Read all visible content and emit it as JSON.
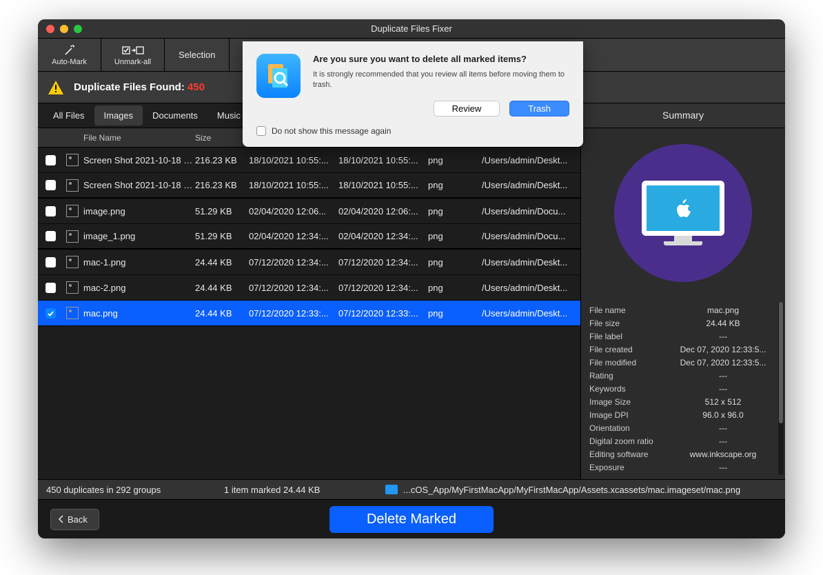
{
  "window": {
    "title": "Duplicate Files Fixer"
  },
  "toolbar": {
    "automark": "Auto-Mark",
    "unmarkall": "Unmark-all",
    "selection": "Selection"
  },
  "alert": {
    "text": "Duplicate Files Found: ",
    "count": "450"
  },
  "tabs": [
    "All Files",
    "Images",
    "Documents",
    "Music"
  ],
  "columns": {
    "name": "File Name",
    "size": "Size"
  },
  "rows": [
    {
      "checked": false,
      "name": "Screen Shot 2021-10-18 a...",
      "size": "216.23 KB",
      "created": "18/10/2021 10:55:...",
      "modified": "18/10/2021 10:55:...",
      "kind": "png",
      "loc": "/Users/admin/Deskt..."
    },
    {
      "checked": false,
      "name": "Screen Shot 2021-10-18 a...",
      "size": "216.23 KB",
      "created": "18/10/2021 10:55:...",
      "modified": "18/10/2021 10:55:...",
      "kind": "png",
      "loc": "/Users/admin/Deskt...",
      "grpend": true
    },
    {
      "checked": false,
      "name": "image.png",
      "size": "51.29 KB",
      "created": "02/04/2020 12:06...",
      "modified": "02/04/2020 12:06:...",
      "kind": "png",
      "loc": "/Users/admin/Docu..."
    },
    {
      "checked": false,
      "name": "image_1.png",
      "size": "51.29 KB",
      "created": "02/04/2020 12:34:...",
      "modified": "02/04/2020 12:34:...",
      "kind": "png",
      "loc": "/Users/admin/Docu...",
      "grpend": true
    },
    {
      "checked": false,
      "name": "mac-1.png",
      "size": "24.44 KB",
      "created": "07/12/2020 12:34:...",
      "modified": "07/12/2020 12:34:...",
      "kind": "png",
      "loc": "/Users/admin/Deskt..."
    },
    {
      "checked": false,
      "name": "mac-2.png",
      "size": "24.44 KB",
      "created": "07/12/2020 12:34:...",
      "modified": "07/12/2020 12:34:...",
      "kind": "png",
      "loc": "/Users/admin/Deskt..."
    },
    {
      "checked": true,
      "name": "mac.png",
      "size": "24.44 KB",
      "created": "07/12/2020 12:33:...",
      "modified": "07/12/2020 12:33:...",
      "kind": "png",
      "loc": "/Users/admin/Deskt...",
      "selected": true
    }
  ],
  "summary": {
    "title": "Summary",
    "props": [
      {
        "k": "File name",
        "v": "mac.png"
      },
      {
        "k": "File size",
        "v": "24.44 KB"
      },
      {
        "k": "File label",
        "v": "---"
      },
      {
        "k": "File created",
        "v": "Dec 07, 2020 12:33:5..."
      },
      {
        "k": "File modified",
        "v": "Dec 07, 2020 12:33:5..."
      },
      {
        "k": "Rating",
        "v": "---"
      },
      {
        "k": "Keywords",
        "v": "---"
      },
      {
        "k": "Image Size",
        "v": "512 x 512"
      },
      {
        "k": "Image DPI",
        "v": "96.0 x 96.0"
      },
      {
        "k": "Orientation",
        "v": "---"
      },
      {
        "k": "Digital zoom ratio",
        "v": "---"
      },
      {
        "k": "Editing software",
        "v": "www.inkscape.org"
      },
      {
        "k": "Exposure",
        "v": "---"
      }
    ]
  },
  "status": {
    "dupes": "450 duplicates in 292 groups",
    "marked": "1 item marked 24.44 KB",
    "path": "...cOS_App/MyFirstMacApp/MyFirstMacApp/Assets.xcassets/mac.imageset/mac.png"
  },
  "buttons": {
    "back": "Back",
    "delete": "Delete Marked"
  },
  "dialog": {
    "title": "Are you sure you want to delete all marked items?",
    "msg": "It is strongly recommended that you review all items before moving them to trash.",
    "review": "Review",
    "trash": "Trash",
    "donotshow": "Do not show this message again"
  }
}
